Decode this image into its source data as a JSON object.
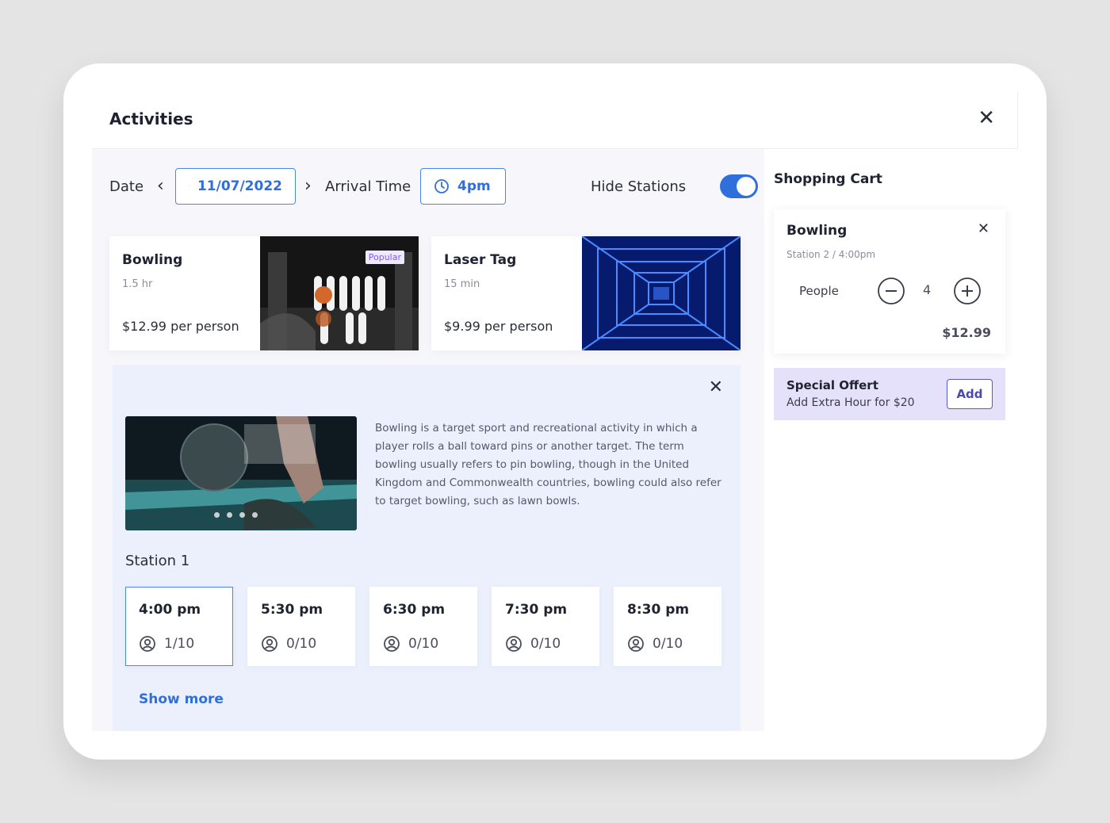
{
  "dialog": {
    "title": "Activities"
  },
  "toolbar": {
    "date_label": "Date",
    "date_value": "11/07/2022",
    "arrival_label": "Arrival Time",
    "arrival_value": "4pm",
    "hide_stations_label": "Hide Stations",
    "hide_stations_on": true
  },
  "activities": [
    {
      "name": "Bowling",
      "duration": "1.5 hr",
      "price": "$12.99 per person",
      "badge": "Popular"
    },
    {
      "name": "Laser Tag",
      "duration": "15 min",
      "price": "$9.99 per person"
    }
  ],
  "detail": {
    "description": "Bowling is a target sport and recreational activity in which a player rolls a ball toward pins or another target. The term bowling usually refers to pin bowling, though in the United Kingdom and Commonwealth countries, bowling could also refer to target bowling, such as lawn bowls.",
    "carousel_count": 4,
    "station_title": "Station 1",
    "slots": [
      {
        "time": "4:00 pm",
        "capacity": "1/10",
        "selected": true
      },
      {
        "time": "5:30 pm",
        "capacity": "0/10",
        "selected": false
      },
      {
        "time": "6:30 pm",
        "capacity": "0/10",
        "selected": false
      },
      {
        "time": "7:30 pm",
        "capacity": "0/10",
        "selected": false
      },
      {
        "time": "8:30 pm",
        "capacity": "0/10",
        "selected": false
      }
    ],
    "show_more": "Show more"
  },
  "cart": {
    "title": "Shopping Cart",
    "item": {
      "name": "Bowling",
      "subtitle": "Station 2 / 4:00pm",
      "people_label": "People",
      "quantity": "4",
      "price": "$12.99"
    },
    "offer": {
      "title": "Special Offert",
      "text": "Add Extra Hour for $20",
      "button": "Add"
    }
  },
  "colors": {
    "accent": "#2f6fdc",
    "offer_bg": "#e6e1fb",
    "detail_bg": "#ebf0fc"
  },
  "icons": [
    "close-icon",
    "chevron-left-icon",
    "chevron-right-icon",
    "calendar-icon",
    "clock-icon",
    "user-icon",
    "minus-icon",
    "plus-icon"
  ]
}
